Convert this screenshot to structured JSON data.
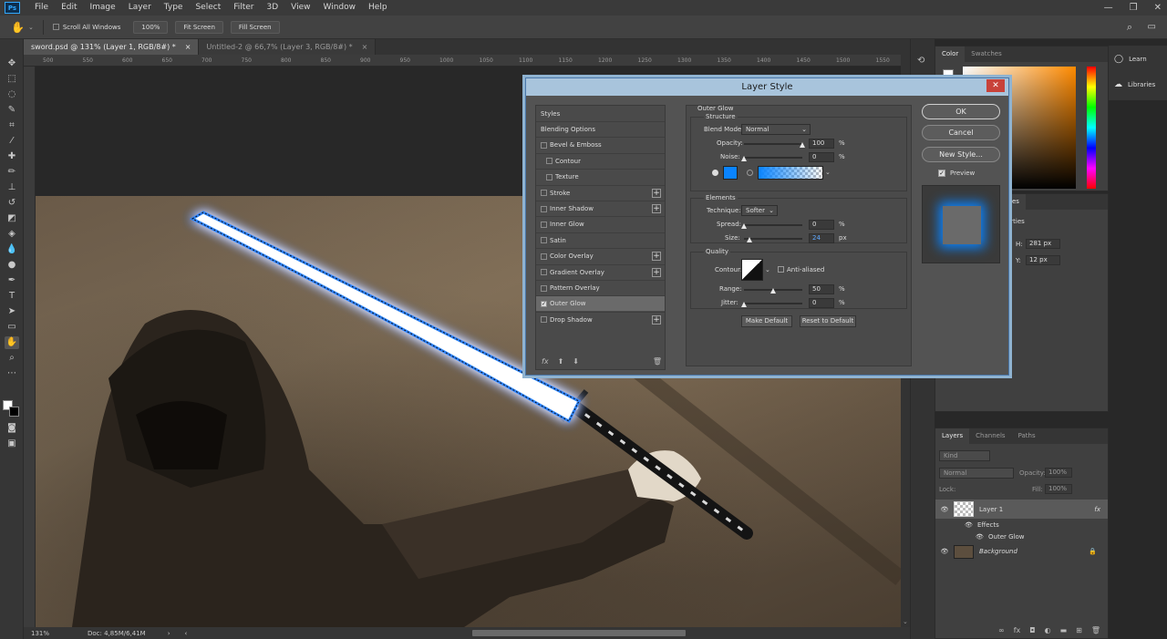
{
  "app": {
    "logo": "Ps"
  },
  "menu": [
    "File",
    "Edit",
    "Image",
    "Layer",
    "Type",
    "Select",
    "Filter",
    "3D",
    "View",
    "Window",
    "Help"
  ],
  "options_bar": {
    "scroll_all_windows": "Scroll All Windows",
    "zoom_value": "100%",
    "fit_screen": "Fit Screen",
    "fill_screen": "Fill Screen"
  },
  "doc_tabs": [
    {
      "label": "sword.psd @ 131% (Layer 1, RGB/8#) *",
      "active": true
    },
    {
      "label": "Untitled-2 @ 66,7% (Layer 3, RGB/8#) *",
      "active": false
    }
  ],
  "ruler_h_ticks": [
    "500",
    "550",
    "600",
    "650",
    "700",
    "750",
    "800",
    "850",
    "900",
    "950",
    "1000",
    "1050",
    "1100",
    "1150",
    "1200",
    "1250",
    "1300",
    "1350",
    "1400",
    "1450",
    "1500",
    "1550"
  ],
  "status": {
    "zoom": "131%",
    "doc": "Doc: 4,85M/6,41M"
  },
  "color_panel": {
    "tabs": [
      "Color",
      "Swatches"
    ],
    "hue_accent": "#ff8a00"
  },
  "properties": {
    "title_fragment": "ies",
    "subtitle_fragment": "erties",
    "h_label": "H:",
    "h_value": "281 px",
    "y_label": "Y:",
    "y_value": "12 px"
  },
  "learn_panel": {
    "learn": "Learn",
    "libraries": "Libraries"
  },
  "layers_panel": {
    "tabs": [
      "Layers",
      "Channels",
      "Paths"
    ],
    "kind_placeholder": "Kind",
    "blend": "Normal",
    "opacity_label": "Opacity:",
    "opacity_value": "100%",
    "lock_label": "Lock:",
    "fill_label": "Fill:",
    "fill_value": "100%",
    "layers": [
      {
        "name": "Layer 1",
        "fx": "fx"
      },
      {
        "name": "Background"
      }
    ],
    "effects_label": "Effects",
    "outer_glow_label": "Outer Glow"
  },
  "dialog": {
    "title": "Layer Style",
    "close": "✕",
    "styles_header": "Styles",
    "items": [
      {
        "label": "Blending Options",
        "check": false,
        "plus": false,
        "indent": false,
        "checked": false
      },
      {
        "label": "Bevel & Emboss",
        "check": true,
        "plus": false,
        "indent": false,
        "checked": false
      },
      {
        "label": "Contour",
        "check": true,
        "plus": false,
        "indent": true,
        "checked": false
      },
      {
        "label": "Texture",
        "check": true,
        "plus": false,
        "indent": true,
        "checked": false
      },
      {
        "label": "Stroke",
        "check": true,
        "plus": true,
        "indent": false,
        "checked": false
      },
      {
        "label": "Inner Shadow",
        "check": true,
        "plus": true,
        "indent": false,
        "checked": false
      },
      {
        "label": "Inner Glow",
        "check": true,
        "plus": false,
        "indent": false,
        "checked": false
      },
      {
        "label": "Satin",
        "check": true,
        "plus": false,
        "indent": false,
        "checked": false
      },
      {
        "label": "Color Overlay",
        "check": true,
        "plus": true,
        "indent": false,
        "checked": false
      },
      {
        "label": "Gradient Overlay",
        "check": true,
        "plus": true,
        "indent": false,
        "checked": false
      },
      {
        "label": "Pattern Overlay",
        "check": true,
        "plus": false,
        "indent": false,
        "checked": false
      },
      {
        "label": "Outer Glow",
        "check": true,
        "plus": false,
        "indent": false,
        "checked": true,
        "selected": true
      },
      {
        "label": "Drop Shadow",
        "check": true,
        "plus": true,
        "indent": false,
        "checked": false
      }
    ],
    "fx_label": "fx",
    "outer_glow": {
      "title": "Outer Glow",
      "structure": "Structure",
      "blend_mode_label": "Blend Mode:",
      "blend_mode": "Normal",
      "opacity_label": "Opacity:",
      "opacity_value": "100",
      "opacity_fraction": 1.0,
      "noise_label": "Noise:",
      "noise_value": "0",
      "noise_fraction": 0.0,
      "glow_color": "#0a84ff",
      "elements": "Elements",
      "technique_label": "Technique:",
      "technique": "Softer",
      "spread_label": "Spread:",
      "spread_value": "0",
      "spread_fraction": 0.0,
      "size_label": "Size:",
      "size_value": "24",
      "size_fraction": 0.1,
      "quality": "Quality",
      "contour_label": "Contour:",
      "anti_aliased": "Anti-aliased",
      "range_label": "Range:",
      "range_value": "50",
      "range_fraction": 0.5,
      "jitter_label": "Jitter:",
      "jitter_value": "0",
      "jitter_fraction": 0.0,
      "percent": "%",
      "px": "px",
      "make_default": "Make Default",
      "reset_default": "Reset to Default"
    },
    "buttons": {
      "ok": "OK",
      "cancel": "Cancel",
      "new_style": "New Style..."
    },
    "preview_label": "Preview"
  }
}
